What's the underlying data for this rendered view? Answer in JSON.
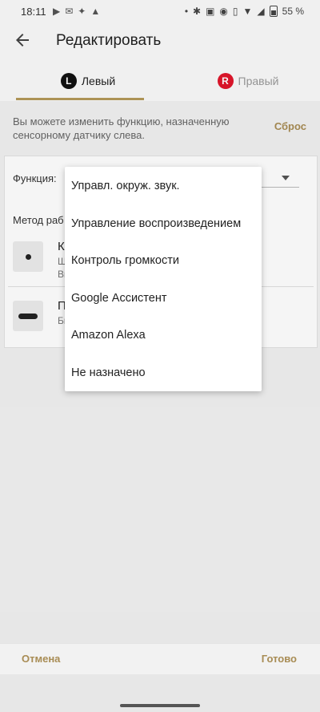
{
  "status_bar": {
    "time": "18:11",
    "battery": "55 %",
    "left_icons": [
      "play-store-icon",
      "messenger-icon",
      "sync-icon",
      "warning-icon"
    ],
    "right_icons": [
      "dot-icon",
      "bluetooth-icon",
      "nfc-icon",
      "location-icon",
      "vibrate-icon",
      "wifi-icon",
      "signal-icon",
      "battery-icon"
    ]
  },
  "header": {
    "title": "Редактировать",
    "back_icon": "arrow-back-icon"
  },
  "tabs": [
    {
      "badge": "L",
      "label": "Левый",
      "active": true,
      "color": "#111111"
    },
    {
      "badge": "R",
      "label": "Правый",
      "active": false,
      "color": "#e0162b"
    }
  ],
  "description": "Вы можете изменить функцию, назначенную сенсорному датчику слева.",
  "reset_label": "Сброс",
  "card": {
    "function_label": "Функция:",
    "method_label": "Метод раб",
    "options": [
      {
        "title": "К",
        "sub1": "Ш",
        "sub2": "Вы",
        "icon": "single-tap-icon"
      },
      {
        "title": "П",
        "sub1": "Бы",
        "icon": "long-press-icon"
      }
    ]
  },
  "dropdown": {
    "items": [
      "Управл. окруж. звук.",
      "Управление воспроизведением",
      "Контроль громкости",
      "Google Ассистент",
      "Amazon Alexa",
      "Не назначено"
    ]
  },
  "footer": {
    "cancel": "Отмена",
    "done": "Готово"
  },
  "colors": {
    "accent": "#b5995a",
    "action_text": "#a88c54",
    "right_badge": "#e0162b"
  }
}
